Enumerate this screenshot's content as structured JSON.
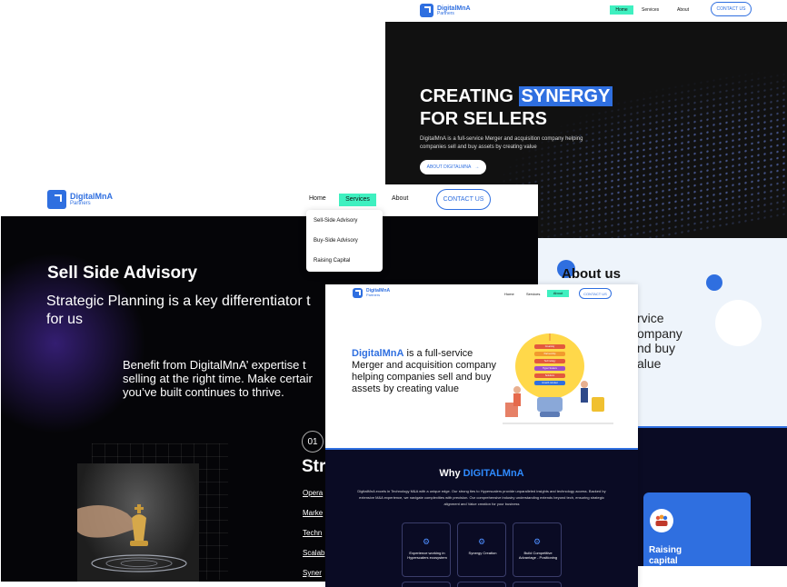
{
  "brand": {
    "name": "DigitalMnA",
    "sub": "Partners"
  },
  "nav": {
    "home": "Home",
    "services": "Services",
    "about": "About",
    "contact": "CONTACT US"
  },
  "hero": {
    "title_line1_a": "CREATING",
    "title_line1_b": "SYNERGY",
    "title_line2": "FOR SELLERS",
    "subtitle": "DigitalMnA is a full-service Merger and acquisition company helping companies sell and buy assets by creating value",
    "cta": "ABOUT DIGITALMNA",
    "cta_arrow": "→"
  },
  "about": {
    "heading": "About us",
    "text_fragments": [
      "rvice",
      "ompany",
      "nd buy",
      "alue"
    ],
    "card_label": "Raising capital"
  },
  "services_menu": [
    "Sell-Side Advisory",
    "Buy-Side Advisory",
    "Raising Capital"
  ],
  "sellside": {
    "title": "Sell Side Advisory",
    "lead": "Strategic Planning is a key differentiator for us",
    "lead_line1": "Strategic Planning is a key differentiator t",
    "lead_line2": "for us",
    "benefit_line1": "Benefit from DigitalMnA’ expertise t",
    "benefit_line2": "selling at the right time. Make certair",
    "benefit_line3": "you’ve built continues to thrive.",
    "step_number": "01",
    "step_title": "Str",
    "step_links": [
      "Opera",
      "Marke",
      "Techn",
      "Scalab",
      "Syner"
    ]
  },
  "front": {
    "intro_brand": "DigitalMnA",
    "intro_rest": " is a full-service Merger and acquisition company helping companies sell and buy assets by creating value",
    "why_prefix": "Why ",
    "why_brand": "DIGITALMnA",
    "why_text": "DigitalMnA excels in Technology M&A with a unique edge. Our strong ties to Hyperscalers provide unparalleled insights and technology access. Backed by extensive M&A experience, we navigate complexities with precision. Our comprehensive industry understanding extends beyond tech, ensuring strategic alignment and Value creation for your business",
    "features": [
      "Experience working in Hyperscalers ecosystem",
      "Synergy Creation",
      "Build Competitive Advantage - Positioning"
    ],
    "bulb_labels": [
      "Creativity",
      "Partnership",
      "Technology",
      "Hyper Scalers",
      "Solutions",
      "Growth mindset"
    ]
  },
  "colors": {
    "accent": "#2f6fe0",
    "mint": "#3ff0c0",
    "dark": "#0a0b24",
    "hero_dark": "#111111"
  }
}
